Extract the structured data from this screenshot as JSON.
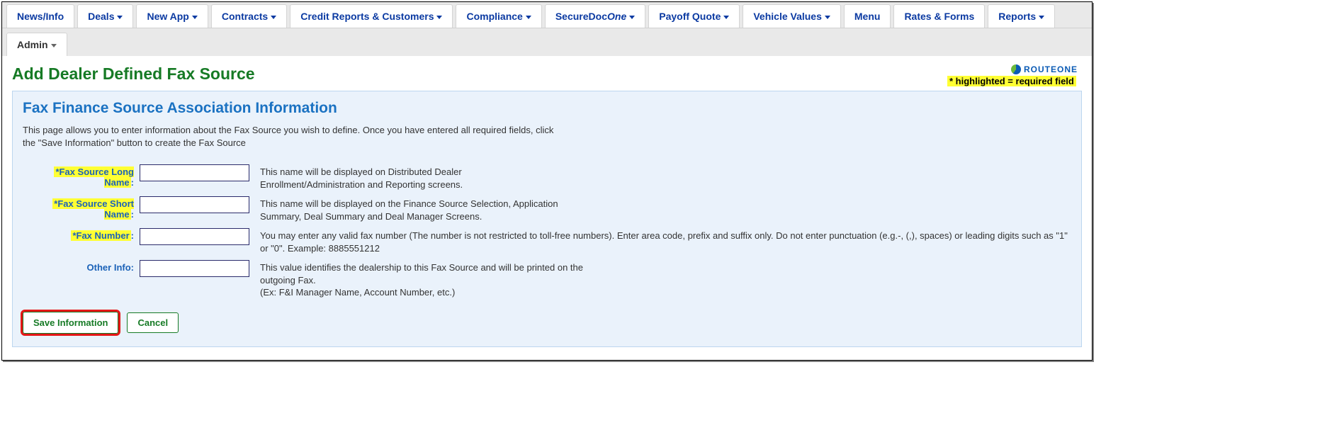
{
  "nav": {
    "row1": [
      {
        "label": "News/Info",
        "caret": false
      },
      {
        "label": "Deals",
        "caret": true
      },
      {
        "label": "New App",
        "caret": true
      },
      {
        "label": "Contracts",
        "caret": true
      },
      {
        "label": "Credit Reports & Customers",
        "caret": true
      },
      {
        "label": "Compliance",
        "caret": true
      },
      {
        "label": "SecureDoc",
        "italic_suffix": "One",
        "caret": true
      },
      {
        "label": "Payoff Quote",
        "caret": true
      },
      {
        "label": "Vehicle Values",
        "caret": true
      },
      {
        "label": "Menu",
        "caret": false
      },
      {
        "label": "Rates & Forms",
        "caret": false
      },
      {
        "label": "Reports",
        "caret": true
      }
    ],
    "row2": [
      {
        "label": "Admin",
        "caret": true
      }
    ]
  },
  "logo_text": "ROUTEONE",
  "page_title": "Add Dealer Defined Fax Source",
  "required_note": "* highlighted = required field",
  "panel_title": "Fax Finance Source Association Information",
  "intro_text": "This page allows you to enter information about the Fax Source you wish to define. Once you have entered all required fields, click the \"Save Information\" button to create the Fax Source",
  "fields": {
    "long_name": {
      "label": "*Fax Source Long Name",
      "value": "",
      "desc": "This name will be displayed on Distributed Dealer Enrollment/Administration and Reporting screens."
    },
    "short_name": {
      "label": "*Fax Source Short Name",
      "value": "",
      "desc": "This name will be displayed on the Finance Source Selection, Application Summary, Deal Summary and Deal Manager Screens."
    },
    "fax_number": {
      "label": "*Fax Number",
      "value": "",
      "desc": "You may enter any valid fax number (The number is not restricted to toll-free numbers). Enter area code, prefix and suffix only. Do not enter punctuation (e.g.-, (,), spaces) or leading digits such as \"1\" or \"0\". Example: 8885551212"
    },
    "other_info": {
      "label": "Other Info",
      "value": "",
      "desc": "This value identifies the dealership to this Fax Source and will be printed on the outgoing Fax.\n(Ex: F&I Manager Name, Account Number, etc.)"
    }
  },
  "buttons": {
    "save": "Save Information",
    "cancel": "Cancel"
  }
}
